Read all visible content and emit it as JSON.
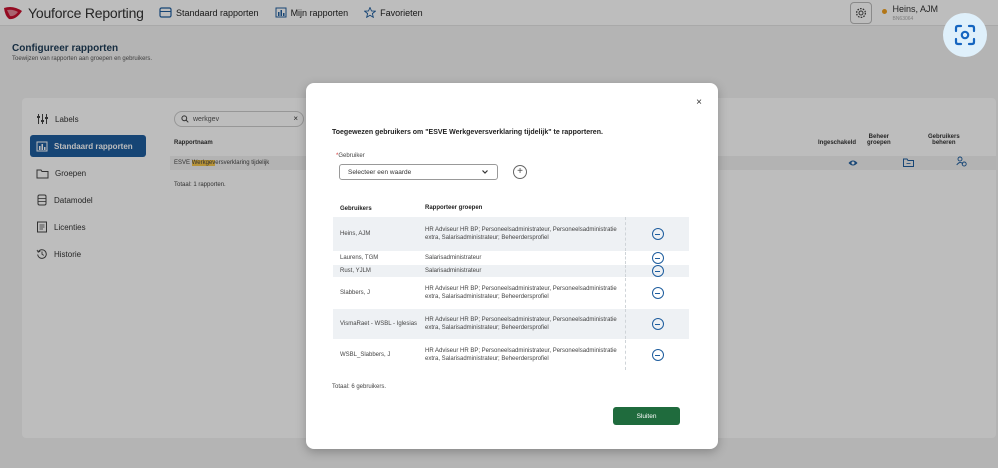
{
  "app": {
    "title": "Youforce Reporting"
  },
  "topnav": [
    {
      "label": "Standaard rapporten",
      "icon": "standard-reports-icon"
    },
    {
      "label": "Mijn rapporten",
      "icon": "bar-chart-icon"
    },
    {
      "label": "Favorieten",
      "icon": "star-icon"
    }
  ],
  "user": {
    "name": "Heins, AJM",
    "sub": "BN63064"
  },
  "page": {
    "title": "Configureer rapporten",
    "subtitle": "Toewijzen van rapporten aan groepen en gebruikers."
  },
  "sidebar": {
    "items": [
      {
        "label": "Labels",
        "icon": "sliders-icon"
      },
      {
        "label": "Standaard rapporten",
        "icon": "bar-chart-icon"
      },
      {
        "label": "Groepen",
        "icon": "folder-icon"
      },
      {
        "label": "Datamodel",
        "icon": "database-icon"
      },
      {
        "label": "Licenties",
        "icon": "document-icon"
      },
      {
        "label": "Historie",
        "icon": "history-icon"
      }
    ]
  },
  "search": {
    "value": "werkgev"
  },
  "reports_table": {
    "header_name": "Rapportnaam",
    "row_prefix": "ESVE ",
    "row_highlight": "Werkgev",
    "row_suffix": "ersverklaring tijdelijk",
    "total": "Totaal: 1 rapporten.",
    "col_enabled": "Ingeschakeld",
    "col_manage_groups_1": "Beheer",
    "col_manage_groups_2": "groepen",
    "col_manage_users_1": "Gebruikers",
    "col_manage_users_2": "beheren"
  },
  "modal": {
    "close_symbol": "×",
    "title": "Toegewezen gebruikers om \"ESVE Werkgeversverklaring tijdelijk\" te rapporteren.",
    "field_label": "Gebruiker",
    "required_mark": "*",
    "select_value": "Selecteer een waarde",
    "add_symbol": "+",
    "col_users": "Gebruikers",
    "col_groups": "Rapporteer groepen",
    "rows": [
      {
        "user": "Heins, AJM",
        "groups": "HR Adviseur HR BP; Personeelsadministrateur, Personeelsadministratie extra, Salarisadministrateur; Beheerdersprofiel"
      },
      {
        "user": "Laurens, TGM",
        "groups": "Salarisadministrateur"
      },
      {
        "user": "Rust, YJLM",
        "groups": "Salarisadministrateur"
      },
      {
        "user": "Slabbers, J",
        "groups": "HR Adviseur HR BP; Personeelsadministrateur, Personeelsadministratie extra, Salarisadministrateur; Beheerdersprofiel"
      },
      {
        "user": "VismaRaet - WSBL - Iglesias",
        "groups": "HR Adviseur HR BP; Personeelsadministrateur, Personeelsadministratie extra, Salarisadministrateur; Beheerdersprofiel"
      },
      {
        "user": "WSBL_Slabbers, J",
        "groups": "HR Adviseur HR BP; Personeelsadministrateur, Personeelsadministratie extra, Salarisadministrateur; Beheerdersprofiel"
      }
    ],
    "total": "Totaal: 6 gebruikers.",
    "close_button": "Sluiten"
  },
  "colors": {
    "primary": "#1e5d9e",
    "close_button": "#1f6b3d",
    "highlight": "#f5c54b",
    "logo_red": "#c8102e"
  }
}
